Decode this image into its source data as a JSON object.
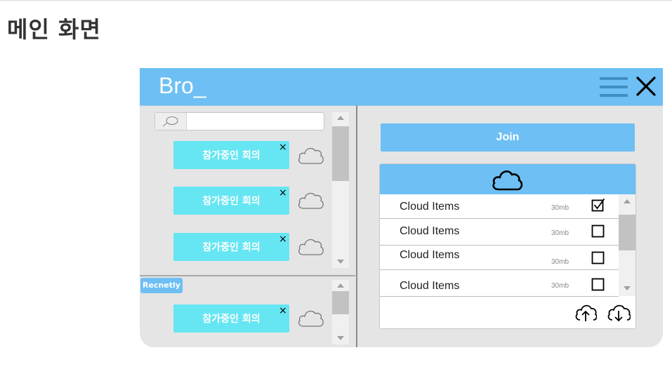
{
  "page": {
    "title": "메인 화면"
  },
  "app": {
    "brand": "Bro_",
    "icons": {
      "menu": "hamburger-menu-icon",
      "close": "close-x-icon"
    }
  },
  "sidebar": {
    "search": {
      "value": "",
      "placeholder": "",
      "icon": "search-icon"
    },
    "meetings": [
      {
        "label": "참가중인 회의",
        "close": "×",
        "icon": "cloud-icon"
      },
      {
        "label": "참가중인 회의",
        "close": "×",
        "icon": "cloud-icon"
      },
      {
        "label": "참가중인 회의",
        "close": "×",
        "icon": "cloud-icon"
      }
    ],
    "recent": {
      "label": "Recnetly",
      "meetings": [
        {
          "label": "참가중인 회의",
          "close": "×",
          "icon": "cloud-icon"
        }
      ]
    }
  },
  "main": {
    "join_label": "Join",
    "cloud": {
      "header_icon": "cloud-icon",
      "items": [
        {
          "name": "Cloud Items",
          "size": "30mb",
          "checked": true
        },
        {
          "name": "Cloud Items",
          "size": "30mb",
          "checked": false
        },
        {
          "name": "Cloud Items",
          "size": "30mb",
          "checked": false
        },
        {
          "name": "Cloud Items",
          "size": "30mb",
          "checked": false
        }
      ],
      "footer_icons": [
        "cloud-upload-icon",
        "cloud-download-icon"
      ]
    }
  },
  "colors": {
    "accent": "#6dbff4",
    "meeting": "#66e6f2",
    "panel": "#e5e5e5"
  }
}
